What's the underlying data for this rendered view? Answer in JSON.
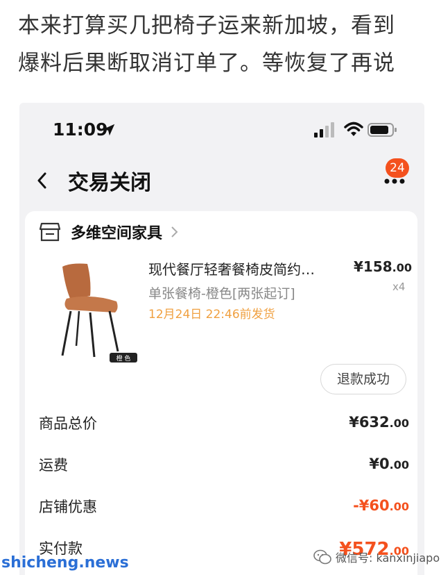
{
  "caption": {
    "line1": "本来打算买几把椅子运来新加坡，看到",
    "line2": "爆料后果断取消订单了。等恢复了再说"
  },
  "status_bar": {
    "time": "11:09"
  },
  "nav": {
    "title": "交易关闭",
    "badge_count": "24"
  },
  "shop": {
    "name": "多维空间家具"
  },
  "product": {
    "title": "现代餐厅轻奢餐椅皮简约…",
    "price_main": "¥158",
    "price_decimal": ".00",
    "variant": "单张餐椅-橙色[两张起订]",
    "quantity": "x4",
    "ship_time": "12月24日 22:46前发货",
    "image_tag": "橙 色",
    "chair_color": "#b86a3e"
  },
  "refund_button": {
    "label": "退款成功"
  },
  "fees": [
    {
      "label": "商品总价",
      "value": "¥632",
      "decimal": ".00"
    },
    {
      "label": "运费",
      "value": "¥0",
      "decimal": ".00"
    },
    {
      "label": "店铺优惠",
      "value": "-¥60",
      "decimal": ".00"
    },
    {
      "label": "实付款",
      "value": "¥572",
      "decimal": ".00"
    }
  ],
  "watermarks": {
    "left": "shicheng.news",
    "right": "微信号: kanxinjiapo"
  },
  "colors": {
    "accent": "#f4511e",
    "ship_time": "#f0a040",
    "watermark": "#2b6fd6"
  }
}
